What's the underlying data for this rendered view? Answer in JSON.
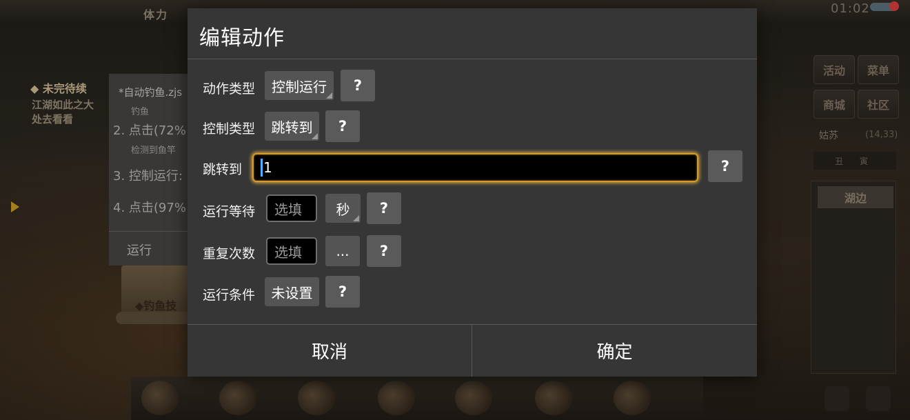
{
  "background": {
    "stat_label": "体力",
    "clock": "01:02",
    "quest": {
      "title": "◆ 未完待续",
      "lines": [
        "江湖如此之大",
        "处去看看"
      ]
    },
    "script_panel": {
      "title": "*自动钓鱼.zjs",
      "steps": [
        {
          "main": "2. 点击(72%",
          "sub": "检测到鱼竿"
        },
        {
          "main": "3. 控制运行:",
          "sub": ""
        },
        {
          "main": "4. 点击(97%",
          "sub": ""
        }
      ],
      "top_fragment": "钓鱼",
      "run_label": "运行"
    },
    "scroll_text": "◆钓鱼技",
    "right_menu": {
      "buttons": [
        "活动",
        "菜单",
        "商城",
        "社区"
      ],
      "location": "姑苏",
      "coords": "(14,33)",
      "sub_label": "丑 寅",
      "lake_label": "湖边"
    }
  },
  "dialog": {
    "title": "编辑动作",
    "rows": {
      "action_type": {
        "label": "动作类型",
        "value": "控制运行",
        "help": "?"
      },
      "control_type": {
        "label": "控制类型",
        "value": "跳转到",
        "help": "?"
      },
      "jump_to": {
        "label": "跳转到",
        "value": "1",
        "help": "?"
      },
      "wait": {
        "label": "运行等待",
        "placeholder": "选填",
        "unit": "秒",
        "help": "?"
      },
      "repeat": {
        "label": "重复次数",
        "placeholder": "选填",
        "more": "...",
        "help": "?"
      },
      "condition": {
        "label": "运行条件",
        "value": "未设置",
        "help": "?"
      }
    },
    "cancel_label": "取消",
    "confirm_label": "确定"
  },
  "colors": {
    "dialog_bg": "#363636",
    "chip_bg": "#545454",
    "focus_ring": "#e8b54a",
    "caret": "#4db0ff"
  }
}
